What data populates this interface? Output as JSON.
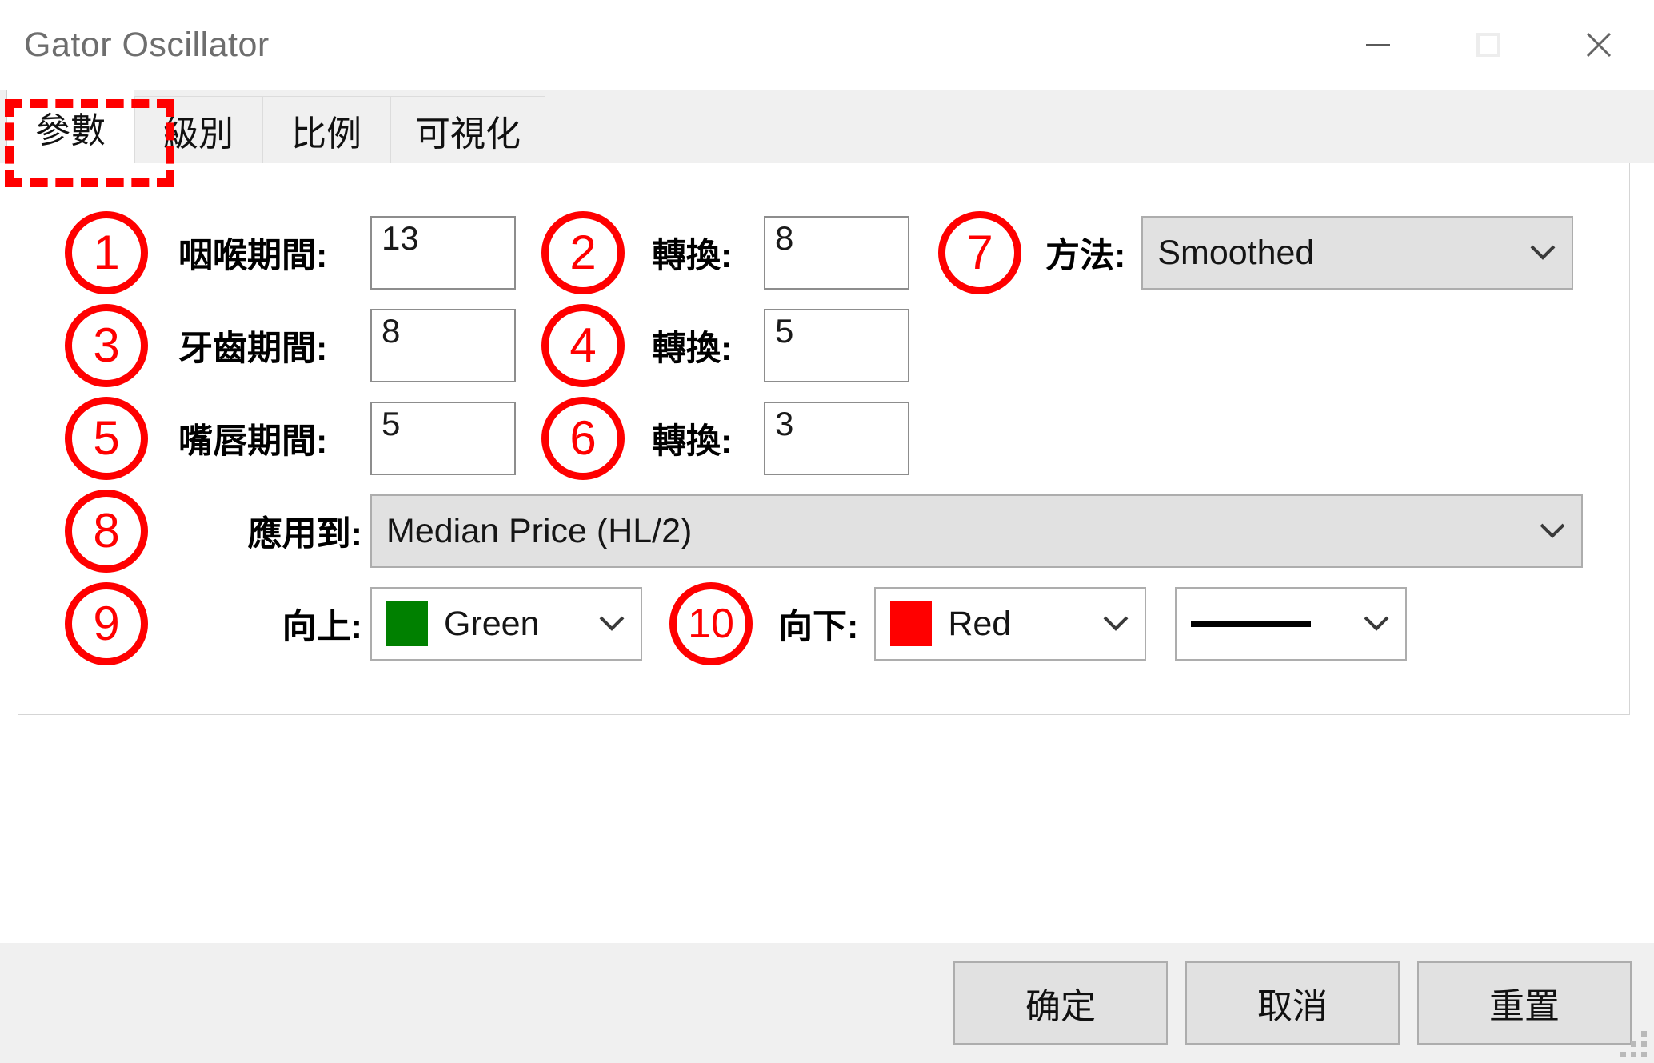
{
  "window": {
    "title": "Gator Oscillator",
    "controls": [
      {
        "name": "minimize",
        "glyph": "—"
      },
      {
        "name": "maximize",
        "glyph": "□"
      },
      {
        "name": "close",
        "glyph": "✕"
      }
    ]
  },
  "tabs": [
    {
      "label": "參數",
      "active": true
    },
    {
      "label": "級別",
      "active": false
    },
    {
      "label": "比例",
      "active": false
    },
    {
      "label": "可視化",
      "active": false
    }
  ],
  "form": {
    "rows": [
      {
        "badge_left": "1",
        "label_left": "咽喉期間:",
        "value_left": "13",
        "badge_mid": "2",
        "label_mid": "轉換:",
        "value_mid": "8",
        "badge_right": "7",
        "label_right": "方法:",
        "value_right": "Smoothed"
      },
      {
        "badge_left": "3",
        "label_left": "牙齒期間:",
        "value_left": "8",
        "badge_mid": "4",
        "label_mid": "轉換:",
        "value_mid": "5"
      },
      {
        "badge_left": "5",
        "label_left": "嘴唇期間:",
        "value_left": "5",
        "badge_mid": "6",
        "label_mid": "轉換:",
        "value_mid": "3"
      }
    ],
    "apply_to": {
      "badge": "8",
      "label": "應用到:",
      "value": "Median Price (HL/2)"
    },
    "colors": {
      "up": {
        "badge": "9",
        "label": "向上:",
        "value": "Green",
        "swatch_color": "#008000"
      },
      "down": {
        "badge": "10",
        "label": "向下:",
        "value": "Red",
        "swatch_color": "#ff0000"
      },
      "line_style": {
        "value": "solid-line"
      }
    }
  },
  "footer": {
    "ok_label": "确定",
    "cancel_label": "取消",
    "reset_label": "重置"
  },
  "annotation": {
    "highlight_color": "#ff0000"
  }
}
